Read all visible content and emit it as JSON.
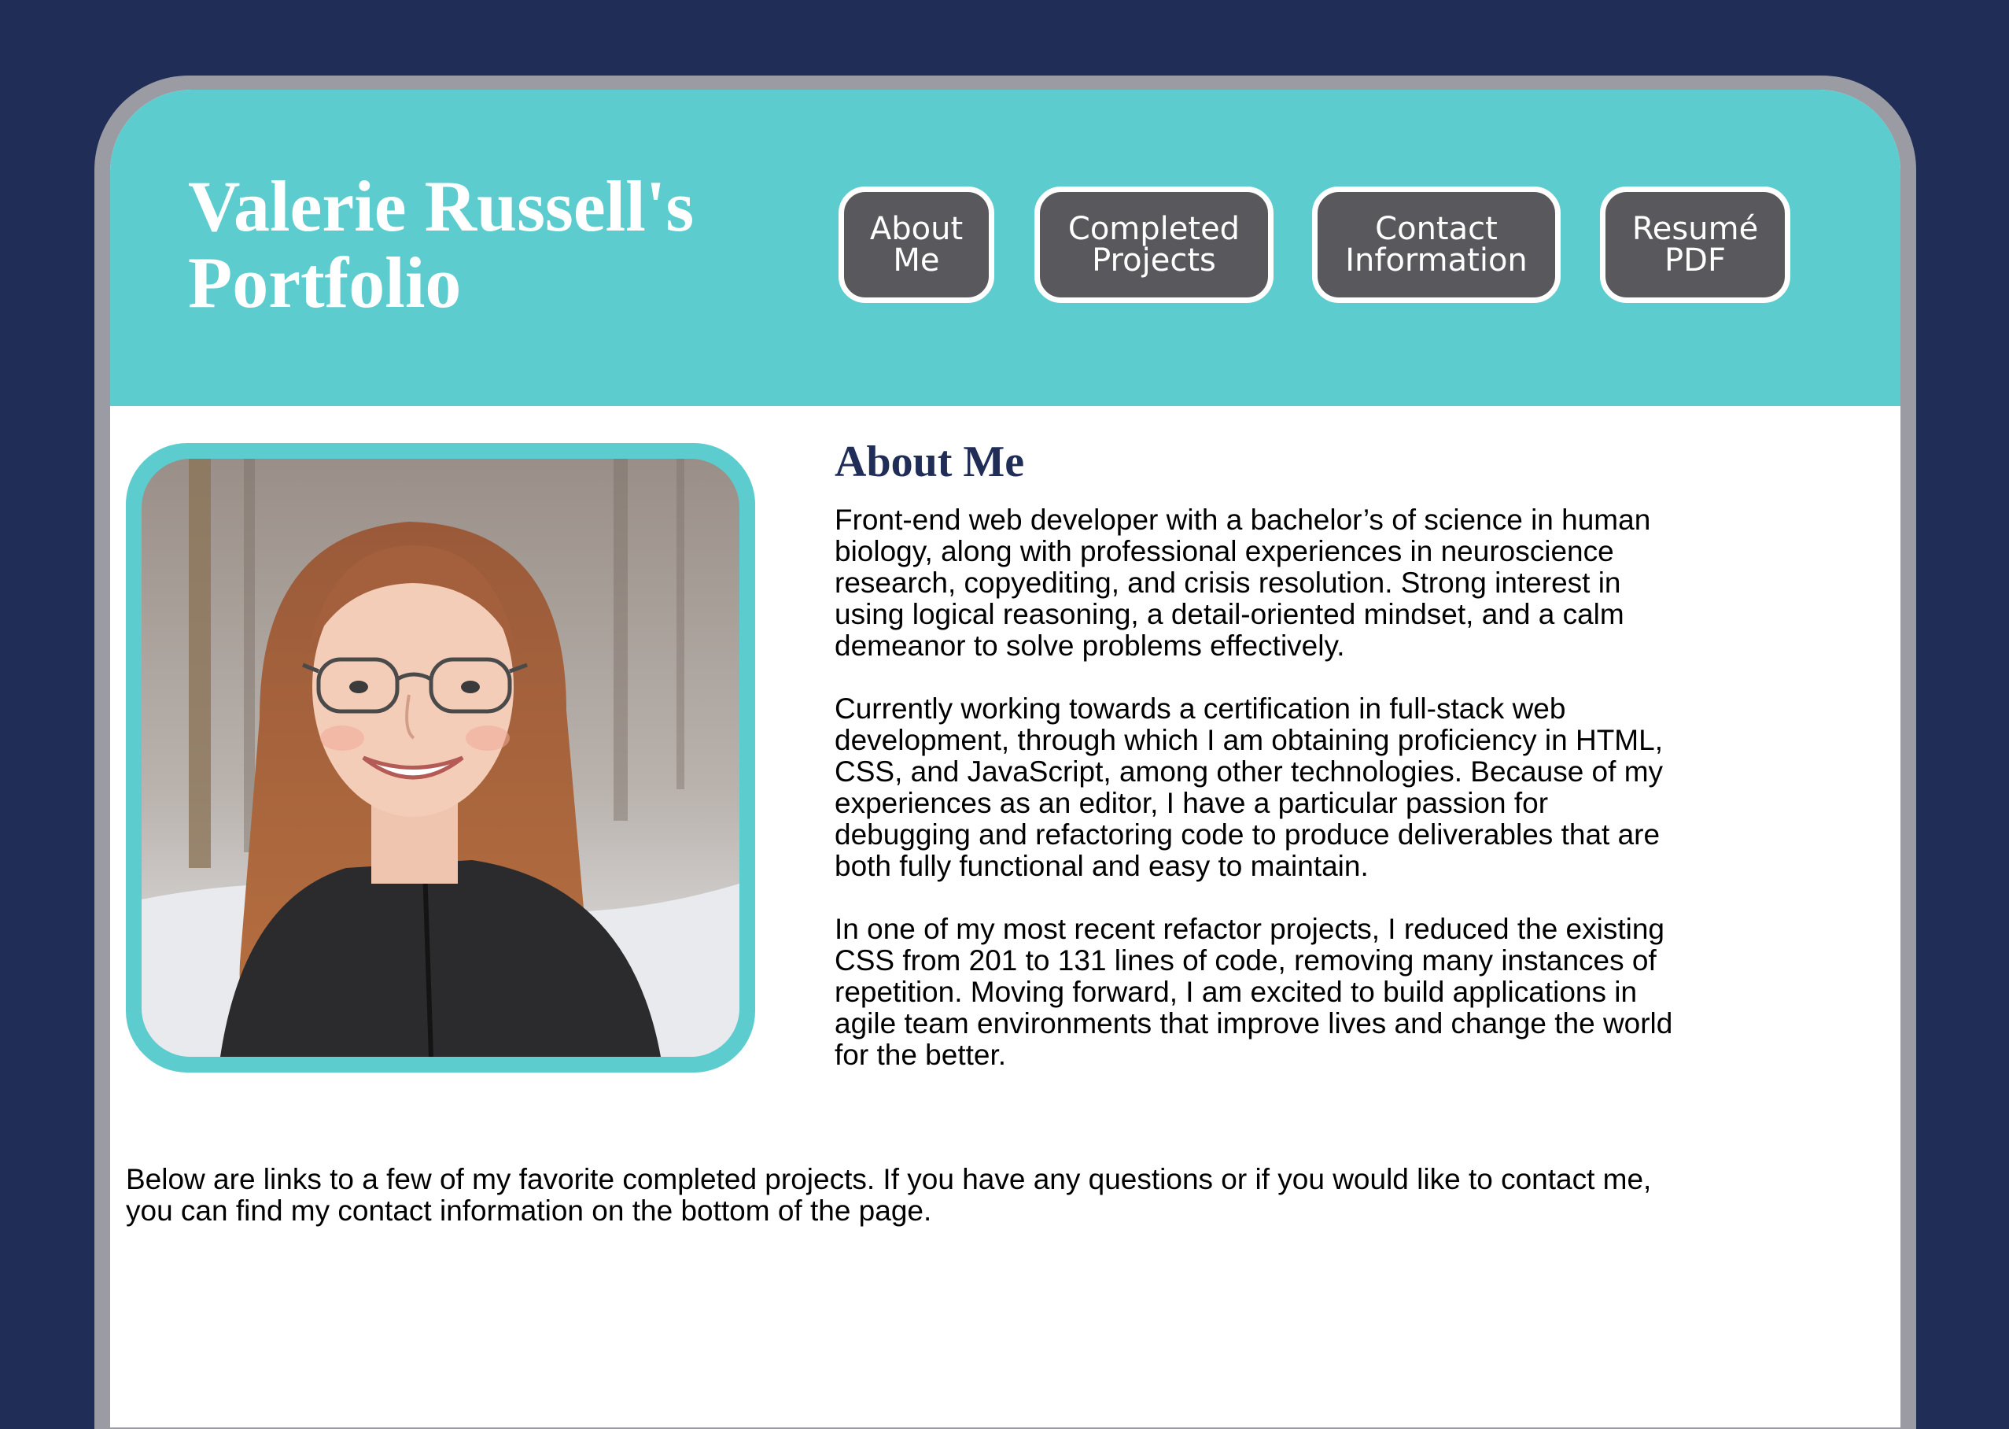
{
  "header": {
    "title": "Valerie Russell's Portfolio",
    "nav": [
      {
        "line1": "About",
        "line2": "Me"
      },
      {
        "line1": "Completed",
        "line2": "Projects"
      },
      {
        "line1": "Contact",
        "line2": "Information"
      },
      {
        "line1": "Resumé",
        "line2": "PDF"
      }
    ]
  },
  "about": {
    "heading": "About Me",
    "paragraphs": [
      "Front-end web developer with a bachelor’s of science in human biology, along with professional experiences in neuroscience research, copyediting, and crisis resolution. Strong interest in using logical reasoning, a detail-oriented mindset, and a calm demeanor to solve problems effectively.",
      "Currently working towards a certification in full-stack web development, through which I am obtaining proficiency in HTML, CSS, and JavaScript, among other technologies. Because of my experiences as an editor, I have a particular passion for debugging and refactoring code to produce deliverables that are both fully functional and easy to maintain.",
      "In one of my most recent refactor projects, I reduced the existing CSS from 201 to 131 lines of code, removing many instances of repetition. Moving forward, I am excited to build applications in agile team environments that improve lives and change the world for the better."
    ]
  },
  "footer_note": "Below are links to a few of my favorite completed projects. If you have any questions or if you would like to contact me, you can find my contact information on the bottom of the page.",
  "colors": {
    "page_background": "#1f2d57",
    "header_teal": "#5ccccf",
    "button_gray": "#59585c",
    "heading_navy": "#1f2d57"
  }
}
